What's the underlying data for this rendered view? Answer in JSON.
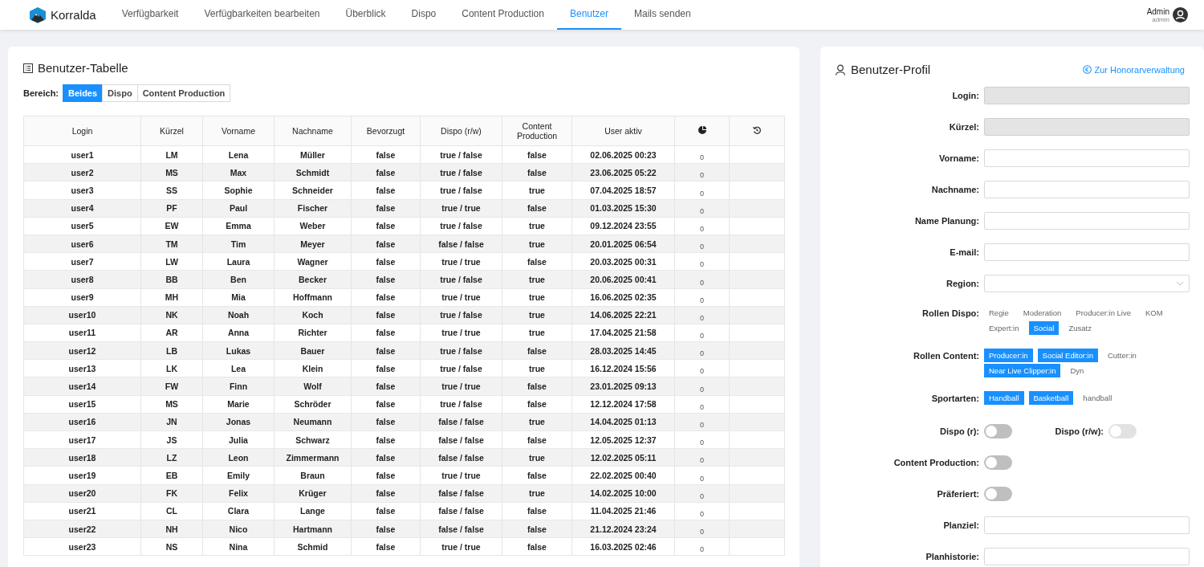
{
  "nav": {
    "brand": "Korralda",
    "items": [
      {
        "label": "Verfügbarkeit",
        "selected": false
      },
      {
        "label": "Verfügbarkeiten bearbeiten",
        "selected": false
      },
      {
        "label": "Überblick",
        "selected": false
      },
      {
        "label": "Dispo",
        "selected": false
      },
      {
        "label": "Content Production",
        "selected": false
      },
      {
        "label": "Benutzer",
        "selected": true
      },
      {
        "label": "Mails senden",
        "selected": false
      }
    ],
    "user": {
      "name": "Admin",
      "role": "admin"
    }
  },
  "table_panel": {
    "title": "Benutzer-Tabelle",
    "filter_label": "Bereich:",
    "filters": [
      {
        "label": "Beides",
        "selected": true
      },
      {
        "label": "Dispo",
        "selected": false
      },
      {
        "label": "Content Production",
        "selected": false
      }
    ],
    "columns": [
      {
        "kind": "text",
        "label": "Login"
      },
      {
        "kind": "text",
        "label": "Kürzel"
      },
      {
        "kind": "text",
        "label": "Vorname"
      },
      {
        "kind": "text",
        "label": "Nachname"
      },
      {
        "kind": "text",
        "label": "Bevorzugt"
      },
      {
        "kind": "text",
        "label": "Dispo (r/w)"
      },
      {
        "kind": "text",
        "label": "Content Production"
      },
      {
        "kind": "text",
        "label": "User aktiv"
      },
      {
        "kind": "pie"
      },
      {
        "kind": "history"
      }
    ],
    "rows": [
      {
        "cells": [
          "user1",
          "LM",
          "Lena",
          "Müller",
          "false",
          "true / false",
          "false",
          "02.06.2025 00:23",
          "0"
        ]
      },
      {
        "cells": [
          "user2",
          "MS",
          "Max",
          "Schmidt",
          "false",
          "true / false",
          "false",
          "23.06.2025 05:22",
          "0"
        ]
      },
      {
        "cells": [
          "user3",
          "SS",
          "Sophie",
          "Schneider",
          "false",
          "true / false",
          "true",
          "07.04.2025 18:57",
          "0"
        ]
      },
      {
        "cells": [
          "user4",
          "PF",
          "Paul",
          "Fischer",
          "false",
          "true / true",
          "false",
          "01.03.2025 15:30",
          "0"
        ]
      },
      {
        "cells": [
          "user5",
          "EW",
          "Emma",
          "Weber",
          "false",
          "true / false",
          "true",
          "09.12.2024 23:55",
          "0"
        ]
      },
      {
        "cells": [
          "user6",
          "TM",
          "Tim",
          "Meyer",
          "false",
          "false / false",
          "true",
          "20.01.2025 06:54",
          "0"
        ]
      },
      {
        "cells": [
          "user7",
          "LW",
          "Laura",
          "Wagner",
          "false",
          "true / true",
          "false",
          "20.03.2025 00:31",
          "0"
        ]
      },
      {
        "cells": [
          "user8",
          "BB",
          "Ben",
          "Becker",
          "false",
          "true / false",
          "true",
          "20.06.2025 00:41",
          "0"
        ]
      },
      {
        "cells": [
          "user9",
          "MH",
          "Mia",
          "Hoffmann",
          "false",
          "true / true",
          "true",
          "16.06.2025 02:35",
          "0"
        ]
      },
      {
        "cells": [
          "user10",
          "NK",
          "Noah",
          "Koch",
          "false",
          "true / false",
          "true",
          "14.06.2025 22:21",
          "0"
        ]
      },
      {
        "cells": [
          "user11",
          "AR",
          "Anna",
          "Richter",
          "false",
          "true / true",
          "true",
          "17.04.2025 21:58",
          "0"
        ]
      },
      {
        "cells": [
          "user12",
          "LB",
          "Lukas",
          "Bauer",
          "false",
          "true / false",
          "false",
          "28.03.2025 14:45",
          "0"
        ]
      },
      {
        "cells": [
          "user13",
          "LK",
          "Lea",
          "Klein",
          "false",
          "true / false",
          "true",
          "16.12.2024 15:56",
          "0"
        ]
      },
      {
        "cells": [
          "user14",
          "FW",
          "Finn",
          "Wolf",
          "false",
          "true / true",
          "false",
          "23.01.2025 09:13",
          "0"
        ]
      },
      {
        "cells": [
          "user15",
          "MS",
          "Marie",
          "Schröder",
          "false",
          "true / false",
          "false",
          "12.12.2024 17:58",
          "0"
        ]
      },
      {
        "cells": [
          "user16",
          "JN",
          "Jonas",
          "Neumann",
          "false",
          "false / false",
          "true",
          "14.04.2025 01:13",
          "0"
        ]
      },
      {
        "cells": [
          "user17",
          "JS",
          "Julia",
          "Schwarz",
          "false",
          "false / false",
          "false",
          "12.05.2025 12:37",
          "0"
        ]
      },
      {
        "cells": [
          "user18",
          "LZ",
          "Leon",
          "Zimmermann",
          "false",
          "false / false",
          "true",
          "12.02.2025 05:11",
          "0"
        ]
      },
      {
        "cells": [
          "user19",
          "EB",
          "Emily",
          "Braun",
          "false",
          "true / true",
          "false",
          "22.02.2025 00:40",
          "0"
        ]
      },
      {
        "cells": [
          "user20",
          "FK",
          "Felix",
          "Krüger",
          "false",
          "false / false",
          "true",
          "14.02.2025 10:00",
          "0"
        ]
      },
      {
        "cells": [
          "user21",
          "CL",
          "Clara",
          "Lange",
          "false",
          "false / false",
          "false",
          "11.04.2025 21:46",
          "0"
        ]
      },
      {
        "cells": [
          "user22",
          "NH",
          "Nico",
          "Hartmann",
          "false",
          "false / false",
          "false",
          "21.12.2024 23:24",
          "0"
        ]
      },
      {
        "cells": [
          "user23",
          "NS",
          "Nina",
          "Schmid",
          "false",
          "true / true",
          "false",
          "16.03.2025 02:46",
          "0"
        ]
      }
    ]
  },
  "profile": {
    "title": "Benutzer-Profil",
    "link": "Zur Honorarverwaltung",
    "fields": [
      {
        "kind": "input",
        "label": "Login:",
        "disabled": true
      },
      {
        "kind": "input",
        "label": "Kürzel:",
        "disabled": true
      },
      {
        "kind": "input",
        "label": "Vorname:",
        "disabled": false
      },
      {
        "kind": "input",
        "label": "Nachname:",
        "disabled": false
      },
      {
        "kind": "input",
        "label": "Name Planung:",
        "disabled": false
      },
      {
        "kind": "input",
        "label": "E-mail:",
        "disabled": false
      },
      {
        "kind": "select",
        "label": "Region:"
      },
      {
        "kind": "tags",
        "label": "Rollen Dispo:",
        "tags": [
          {
            "label": "Regie",
            "selected": false
          },
          {
            "label": "Moderation",
            "selected": false
          },
          {
            "label": "Producer:in Live",
            "selected": false
          },
          {
            "label": "KOM",
            "selected": false
          },
          {
            "label": "Expert:in",
            "selected": false
          },
          {
            "label": "Social",
            "selected": true
          },
          {
            "label": "Zusatz",
            "selected": false
          }
        ]
      },
      {
        "kind": "tags",
        "label": "Rollen Content:",
        "tags": [
          {
            "label": "Producer:in",
            "selected": true
          },
          {
            "label": "Social Editor:in",
            "selected": true
          },
          {
            "label": "Cutter:in",
            "selected": false
          },
          {
            "label": "Near Live Clipper:in",
            "selected": true
          },
          {
            "label": "Dyn",
            "selected": false
          }
        ]
      },
      {
        "kind": "tags",
        "label": "Sportarten:",
        "tags": [
          {
            "label": "Handball",
            "selected": true
          },
          {
            "label": "Basketball",
            "selected": true
          },
          {
            "label": "handball",
            "selected": false
          }
        ]
      },
      {
        "kind": "toggles",
        "toggles": [
          {
            "label": "Dispo (r):",
            "on": false,
            "disabled": false
          },
          {
            "label": "Dispo (r/w):",
            "on": false,
            "disabled": true
          }
        ]
      },
      {
        "kind": "toggles",
        "toggles": [
          {
            "label": "Content Production:",
            "on": false,
            "disabled": false
          }
        ]
      },
      {
        "kind": "toggles",
        "toggles": [
          {
            "label": "Präferiert:",
            "on": false,
            "disabled": false
          }
        ]
      },
      {
        "kind": "input",
        "label": "Planziel:",
        "disabled": false
      },
      {
        "kind": "input",
        "label": "Planhistorie:",
        "disabled": false
      }
    ]
  }
}
